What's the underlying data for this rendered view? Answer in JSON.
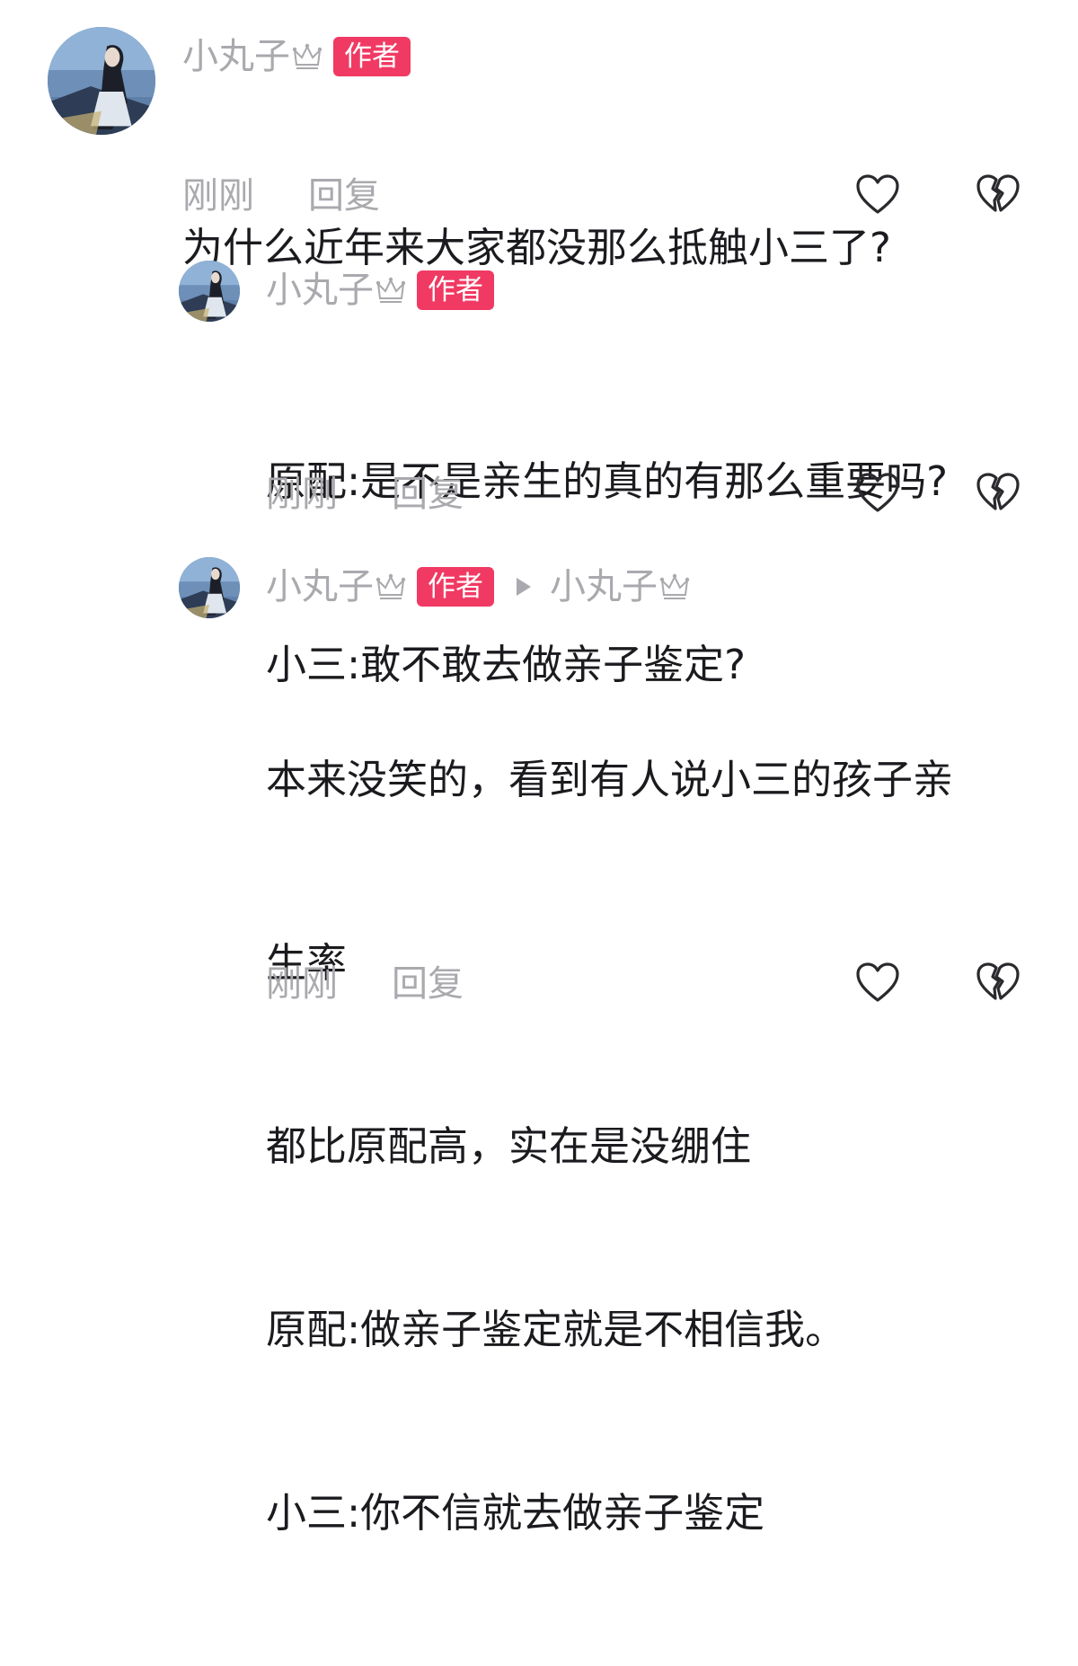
{
  "comments": [
    {
      "username": "小丸子",
      "badge": "作者",
      "text_lines": [
        "为什么近年来大家都没那么抵触小三了?"
      ],
      "time": "刚刚",
      "reply_label": "回复",
      "like_icon": "heart-icon",
      "dislike_icon": "broken-heart-icon"
    },
    {
      "username": "小丸子",
      "badge": "作者",
      "text_lines": [
        "原配:是不是亲生的真的有那么重要吗?",
        "小三:敢不敢去做亲子鉴定?"
      ],
      "time": "刚刚",
      "reply_label": "回复",
      "like_icon": "heart-icon",
      "dislike_icon": "broken-heart-icon"
    },
    {
      "username": "小丸子",
      "badge": "作者",
      "reply_to": "小丸子",
      "text_lines": [
        "本来没笑的，看到有人说小三的孩子亲",
        "生率",
        "都比原配高，实在是没绷住",
        "原配:做亲子鉴定就是不相信我。",
        "小三:你不信就去做亲子鉴定"
      ],
      "time": "刚刚",
      "reply_label": "回复",
      "like_icon": "heart-icon",
      "dislike_icon": "broken-heart-icon"
    }
  ],
  "colors": {
    "badge": "#f03a63",
    "muted": "#a9a9ae",
    "text": "#1b1b1f"
  }
}
